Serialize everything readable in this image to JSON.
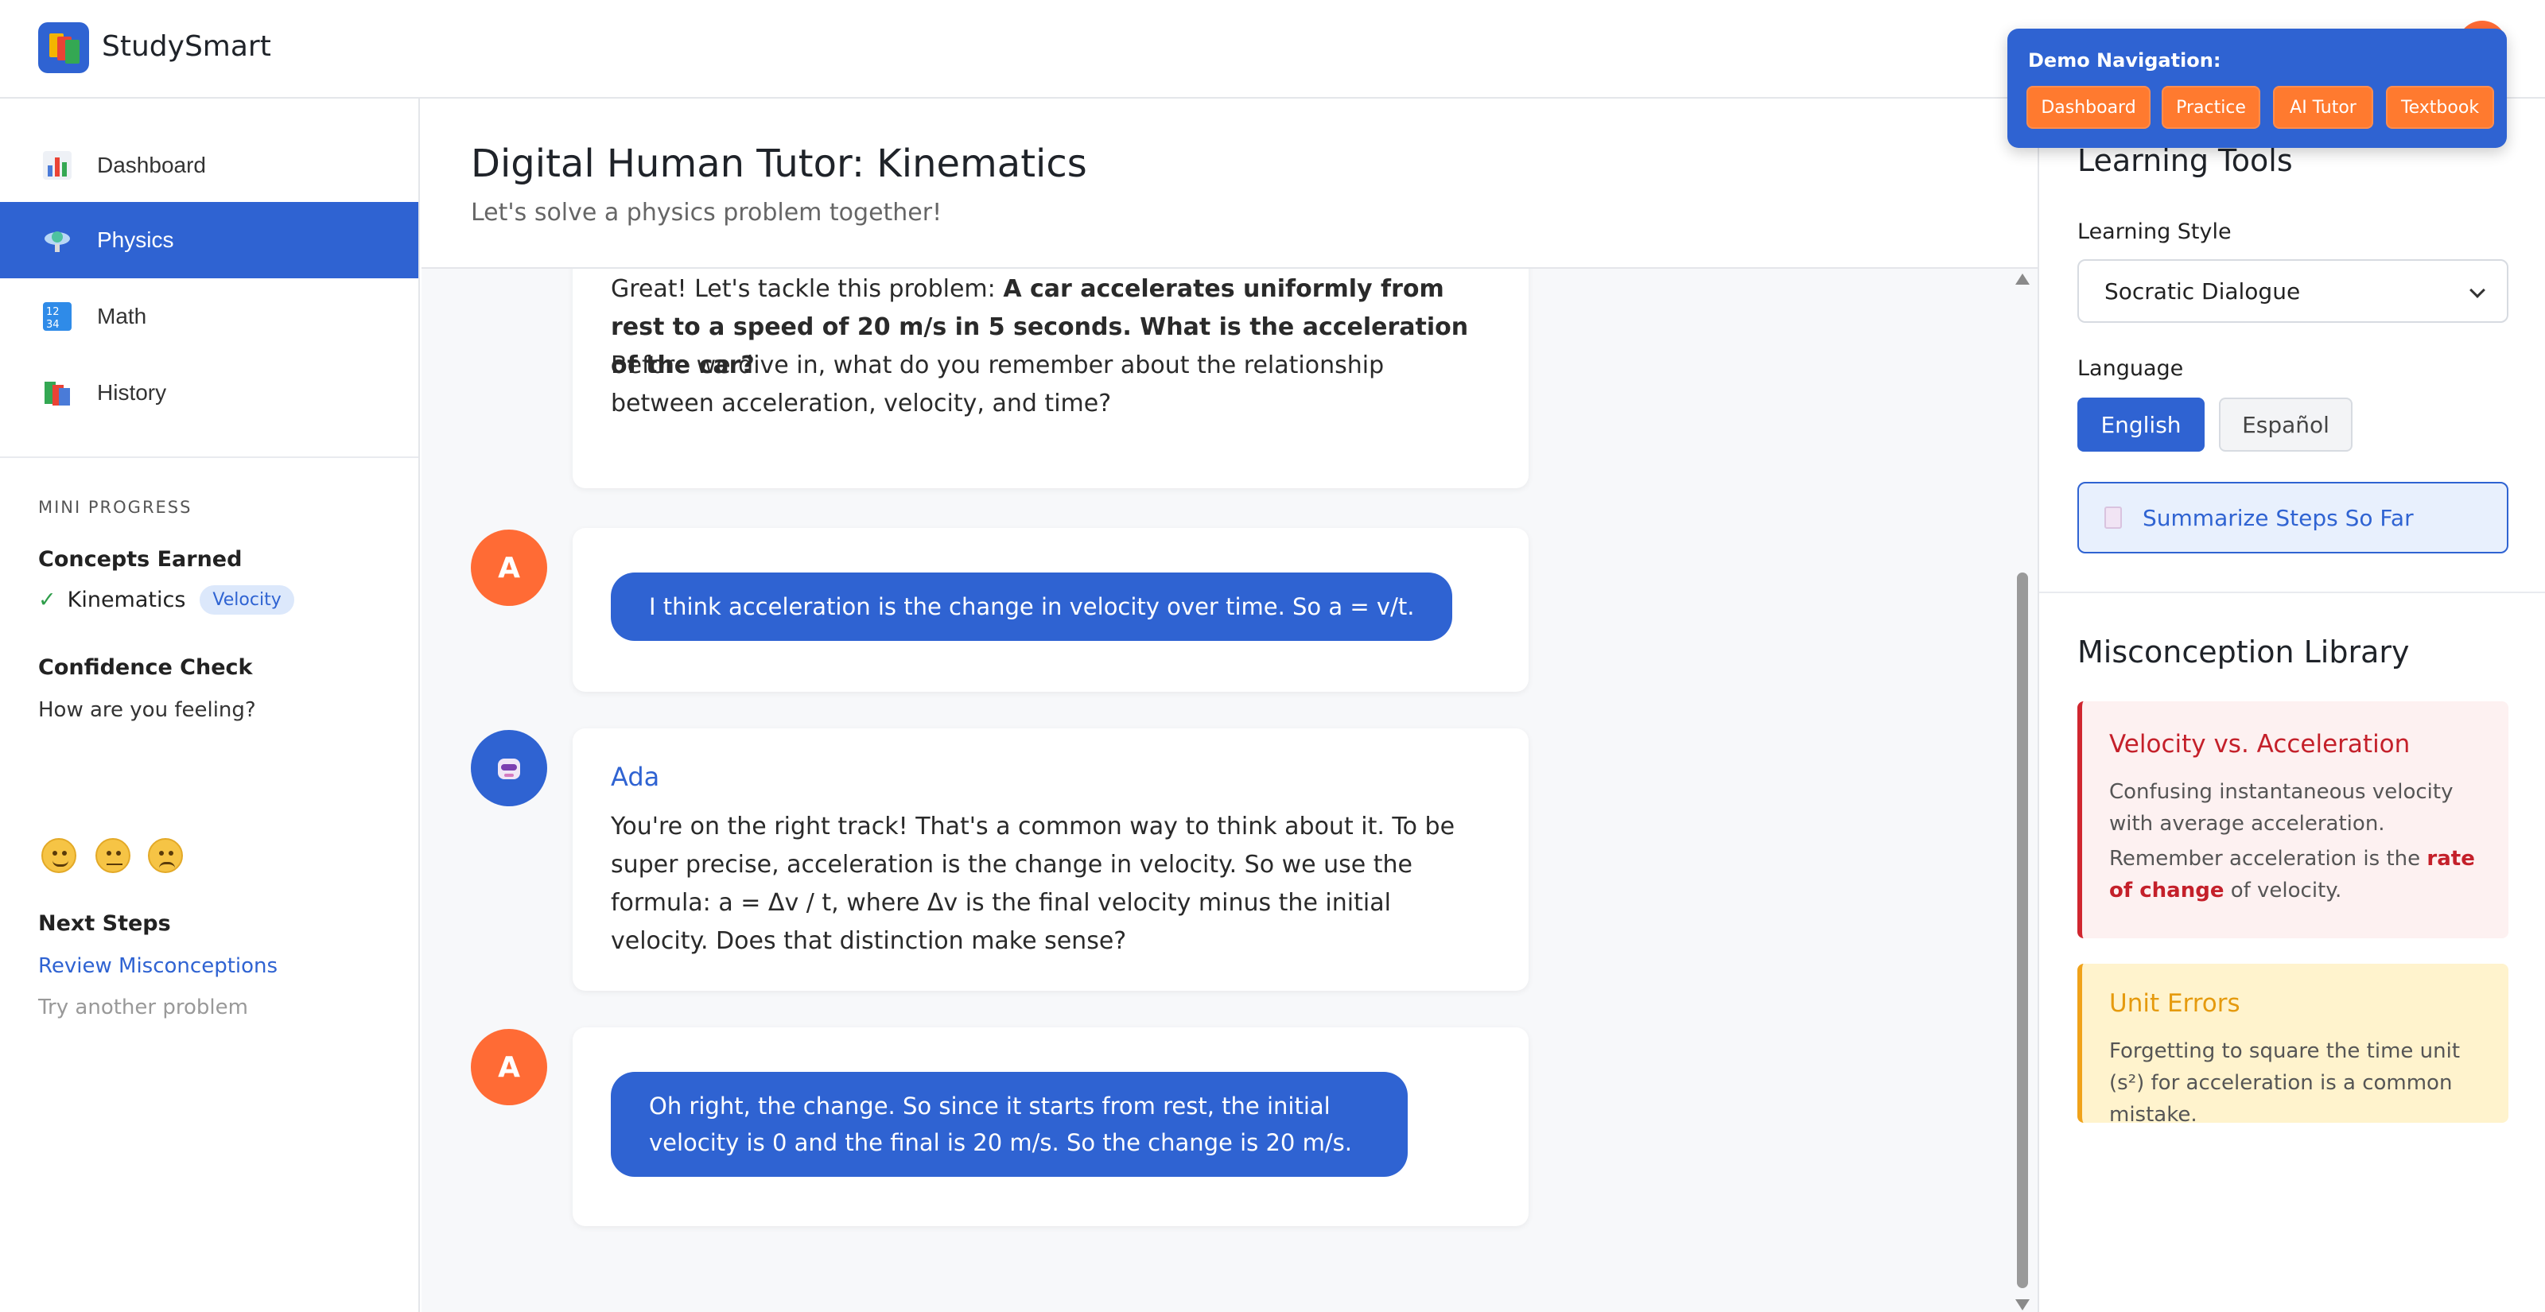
{
  "app": {
    "name": "StudySmart"
  },
  "demo_nav": {
    "title": "Demo Navigation:",
    "buttons": [
      "Dashboard",
      "Practice",
      "AI Tutor",
      "Textbook"
    ]
  },
  "sidebar": {
    "items": [
      {
        "label": "Dashboard",
        "icon": "bar-chart-icon"
      },
      {
        "label": "Physics",
        "icon": "physics-icon",
        "active": true
      },
      {
        "label": "Math",
        "icon": "numbers-icon"
      },
      {
        "label": "History",
        "icon": "books-icon"
      }
    ],
    "mini_progress_label": "MINI PROGRESS",
    "concepts_title": "Concepts Earned",
    "concept_check": "✓",
    "concept_done": "Kinematics",
    "concept_tag": "Velocity",
    "confidence_title": "Confidence Check",
    "confidence_prompt": "How are you feeling?",
    "next_steps_title": "Next Steps",
    "next_link": "Review Misconceptions",
    "next_disabled": "Try another problem"
  },
  "main": {
    "title": "Digital Human Tutor: Kinematics",
    "subtitle": "Let's solve a physics problem together!",
    "messages": [
      {
        "intro": "Great! Let's tackle this problem: ",
        "bold": "A car accelerates uniformly from rest to a speed of 20 m/s in 5 seconds. What is the acceleration of the car?",
        "follow": "Before we dive in, what do you remember about the relationship between acceleration, velocity, and time?"
      },
      {
        "avatar": "A",
        "text": "I think acceleration is the change in velocity over time. So a = v/t."
      },
      {
        "name": "Ada",
        "text": "You're on the right track! That's a common way to think about it. To be super precise, acceleration is the change in velocity. So we use the formula: a = Δv / t, where Δv is the final velocity minus the initial velocity. Does that distinction make sense?"
      },
      {
        "avatar": "A",
        "text": "Oh right, the change. So since it starts from rest, the initial velocity is 0 and the final is 20 m/s. So the change is 20 m/s."
      }
    ]
  },
  "right": {
    "tools_title": "Learning Tools",
    "style_label": "Learning Style",
    "style_value": "Socratic Dialogue",
    "language_label": "Language",
    "lang_en": "English",
    "lang_es": "Español",
    "summarize": "Summarize Steps So Far",
    "misc_title": "Misconception Library",
    "cards": [
      {
        "title": "Velocity vs. Acceleration",
        "text": "Confusing instantaneous velocity with average acceleration.",
        "text2_a": "Remember acceleration is the ",
        "text2_strong": "rate of change",
        "text2_b": " of velocity."
      },
      {
        "title": "Unit Errors",
        "text": "Forgetting to square the time unit (s²) for acceleration is a common mistake."
      }
    ]
  },
  "colors": {
    "primary": "#2f63d2",
    "accent": "#ff6b35",
    "error": "#d0262f",
    "warning": "#f0a21a"
  }
}
